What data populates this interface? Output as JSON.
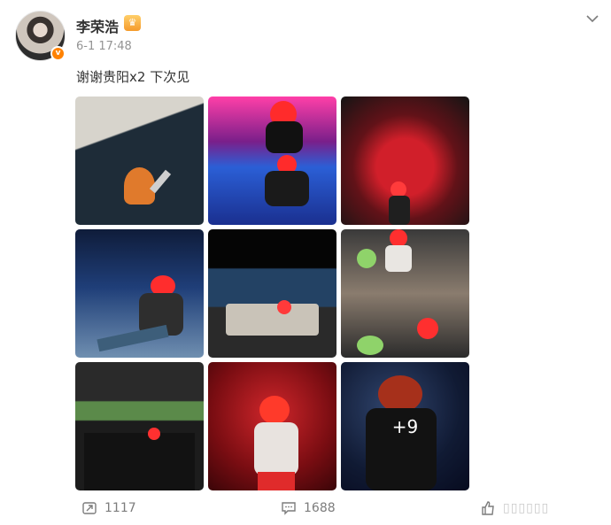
{
  "post": {
    "username": "李荣浩",
    "verified_mark": "v",
    "member_badge_icon": "crown-badge-icon",
    "timestamp": "6-1 17:48",
    "text": "谢谢贵阳x2 下次见",
    "more_photos_label": "+9"
  },
  "images": [
    {
      "name": "photo-1"
    },
    {
      "name": "photo-2"
    },
    {
      "name": "photo-3"
    },
    {
      "name": "photo-4"
    },
    {
      "name": "photo-5"
    },
    {
      "name": "photo-6"
    },
    {
      "name": "photo-7"
    },
    {
      "name": "photo-8"
    },
    {
      "name": "photo-9"
    }
  ],
  "actions": {
    "repost_count": "1117",
    "comment_count": "1688",
    "like_count": "▯▯▯▯▯▯"
  },
  "colors": {
    "verified": "#ff8200",
    "text": "#333333",
    "muted": "#939393"
  }
}
